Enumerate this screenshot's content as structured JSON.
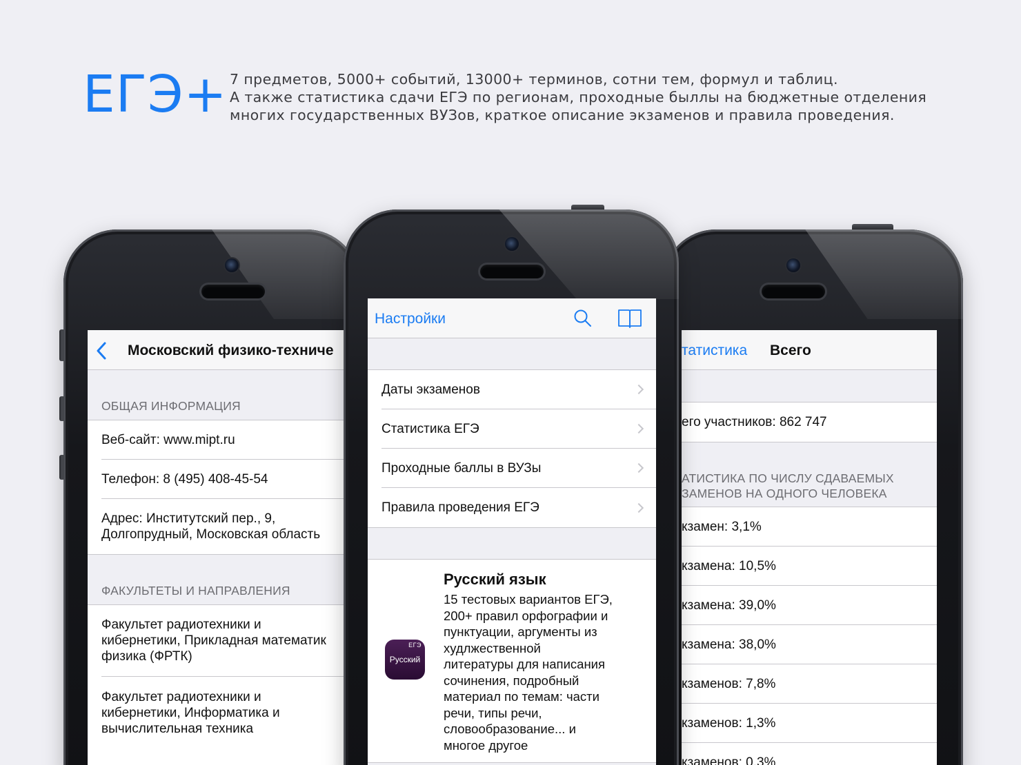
{
  "header": {
    "logo": "ЕГЭ+",
    "tagline_lines": [
      "7 предметов, 5000+ событий, 13000+ терминов, сотни тем, формул и таблиц.",
      "А также статистика сдачи ЕГЭ по регионам, проходные быллы на бюджетные отделения",
      "многих государственных ВУЗов, краткое описание экзаменов и правила проведения."
    ]
  },
  "colors": {
    "accent": "#1b7cf2",
    "background": "#efeff4",
    "icon_purple": "#3a1445"
  },
  "left_phone": {
    "nav_title": "Московский физико-техниче",
    "sections": [
      {
        "header": "ОБЩАЯ ИНФОРМАЦИЯ",
        "rows": [
          "Веб-сайт: www.mipt.ru",
          "Телефон: 8 (495) 408-45-54",
          "Адрес: Институтский пер., 9,\nДолгопрудный, Московская область"
        ]
      },
      {
        "header": "ФАКУЛЬТЕТЫ И НАПРАВЛЕНИЯ",
        "rows": [
          "Факультет радиотехники и\nкибернетики, Прикладная математик\nфизика (ФРТК)",
          "Факультет радиотехники и\nкибернетики, Информатика и\nвычислительная техника"
        ]
      }
    ]
  },
  "center_phone": {
    "nav_link": "Настройки",
    "menu": [
      "Даты экзаменов",
      "Статистика ЕГЭ",
      "Проходные баллы в ВУЗы",
      "Правила проведения ЕГЭ"
    ],
    "promo": {
      "title": "Русский язык",
      "description": "15 тестовых вариантов ЕГЭ,\n200+ правил орфографии и\nпунктуации, аргументы из\nхудлжественной\nлитературы для написания\nсочинения, подробный\nматериал по темам: части\nречи, типы речи,\nсловообразование... и\nмногое другое",
      "icon_tag": "ЕГЭ",
      "icon_label": "Русский"
    }
  },
  "right_phone": {
    "nav_back": "татистика",
    "nav_title": "Всего",
    "total": "его участников: 862 747",
    "section_header": "АТИСТИКА ПО ЧИСЛУ СДАВАЕМЫХ\nЗАМЕНОВ НА ОДНОГО ЧЕЛОВЕКА",
    "rows": [
      "кзамен: 3,1%",
      "кзамена: 10,5%",
      "кзамена: 39,0%",
      "кзамена: 38,0%",
      "кзаменов: 7,8%",
      "кзаменов: 1,3%",
      "кзаменов: 0,3%"
    ]
  }
}
